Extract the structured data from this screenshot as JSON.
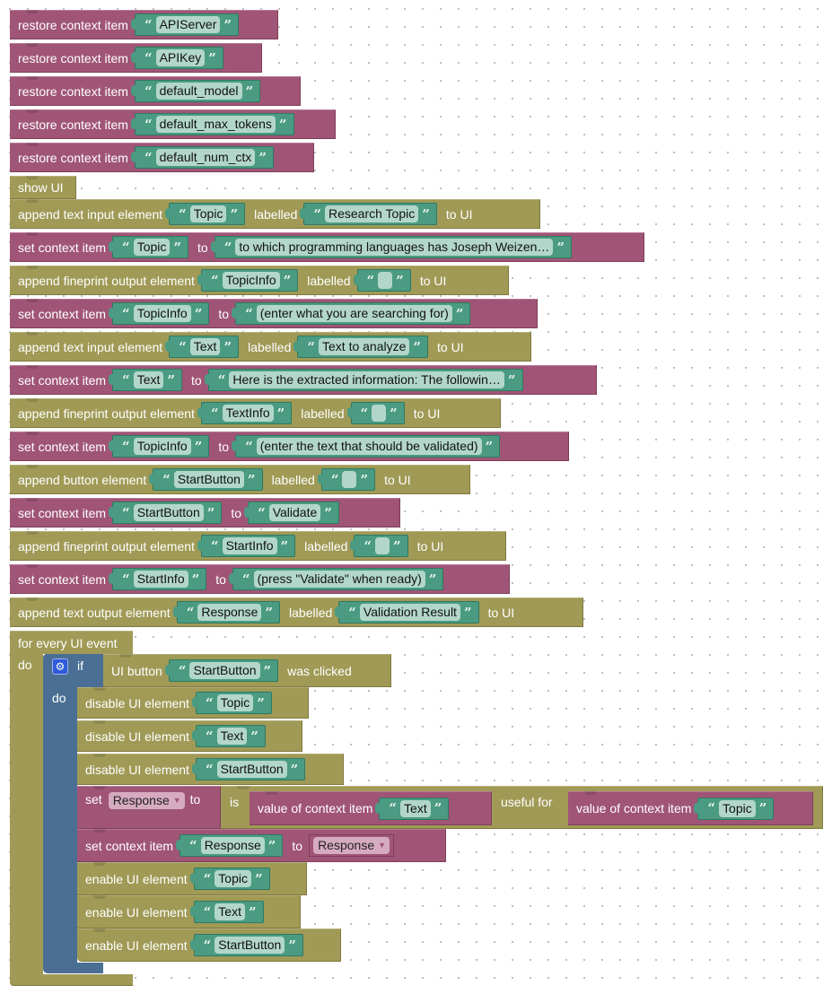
{
  "workspace": {
    "blocks": [
      {
        "type": "restore",
        "label": "restore context item",
        "key": "APIServer"
      },
      {
        "type": "restore",
        "label": "restore context item",
        "key": "APIKey"
      },
      {
        "type": "restore",
        "label": "restore context item",
        "key": "default_model"
      },
      {
        "type": "restore",
        "label": "restore context item",
        "key": "default_max_tokens"
      },
      {
        "type": "restore",
        "label": "restore context item",
        "key": "default_num_ctx"
      },
      {
        "type": "show",
        "label": "show UI"
      },
      {
        "type": "append",
        "label": "append text input element",
        "name": "Topic",
        "labelled": "labelled",
        "caption": "Research Topic",
        "suffix": "to UI"
      },
      {
        "type": "set",
        "label": "set context item",
        "key": "Topic",
        "to": "to",
        "value": "to which programming languages has Joseph Weizen…"
      },
      {
        "type": "append",
        "label": "append fineprint output element",
        "name": "TopicInfo",
        "labelled": "labelled",
        "caption": "",
        "suffix": "to UI"
      },
      {
        "type": "set",
        "label": "set context item",
        "key": "TopicInfo",
        "to": "to",
        "value": "(enter what you are searching for)"
      },
      {
        "type": "append",
        "label": "append text input element",
        "name": "Text",
        "labelled": "labelled",
        "caption": "Text to analyze",
        "suffix": "to UI"
      },
      {
        "type": "set",
        "label": "set context item",
        "key": "Text",
        "to": "to",
        "value": "Here is the extracted information:  The followin…"
      },
      {
        "type": "append",
        "label": "append fineprint output element",
        "name": "TextInfo",
        "labelled": "labelled",
        "caption": "",
        "suffix": "to UI"
      },
      {
        "type": "set",
        "label": "set context item",
        "key": "TopicInfo",
        "to": "to",
        "value": "(enter the text that should be validated)"
      },
      {
        "type": "append",
        "label": "append button element",
        "name": "StartButton",
        "labelled": "labelled",
        "caption": "",
        "suffix": "to UI"
      },
      {
        "type": "set",
        "label": "set context item",
        "key": "StartButton",
        "to": "to",
        "value": "Validate"
      },
      {
        "type": "append",
        "label": "append fineprint output element",
        "name": "StartInfo",
        "labelled": "labelled",
        "caption": "",
        "suffix": "to UI"
      },
      {
        "type": "set",
        "label": "set context item",
        "key": "StartInfo",
        "to": "to",
        "value": "(press \"Validate\" when ready)"
      },
      {
        "type": "append",
        "label": "append text output element",
        "name": "Response",
        "labelled": "labelled",
        "caption": "Validation Result",
        "suffix": "to UI"
      }
    ],
    "loop": {
      "label": "for every UI event",
      "do": "do",
      "if_block": {
        "if_label": "if",
        "do_label": "do",
        "condition": {
          "prefix": "UI button",
          "name": "StartButton",
          "suffix": "was clicked"
        },
        "body": [
          {
            "label": "disable UI element",
            "name": "Topic"
          },
          {
            "label": "disable UI element",
            "name": "Text"
          },
          {
            "label": "disable UI element",
            "name": "StartButton"
          }
        ],
        "set_var": {
          "set": "set",
          "var": "Response",
          "to": "to",
          "is": "is",
          "left": {
            "label": "value of context item",
            "key": "Text"
          },
          "useful_for": "useful for",
          "right": {
            "label": "value of context item",
            "key": "Topic"
          }
        },
        "set_ctx": {
          "label": "set context item",
          "key": "Response",
          "to": "to",
          "var": "Response"
        },
        "body2": [
          {
            "label": "enable UI element",
            "name": "Topic"
          },
          {
            "label": "enable UI element",
            "name": "Text"
          },
          {
            "label": "enable UI element",
            "name": "StartButton"
          }
        ]
      }
    },
    "colors": {
      "context": "#a05576",
      "ui": "#a09a56",
      "text": "#4a9b82",
      "logic": "#4b6f94"
    },
    "quote_open": "“",
    "quote_close": "”"
  }
}
